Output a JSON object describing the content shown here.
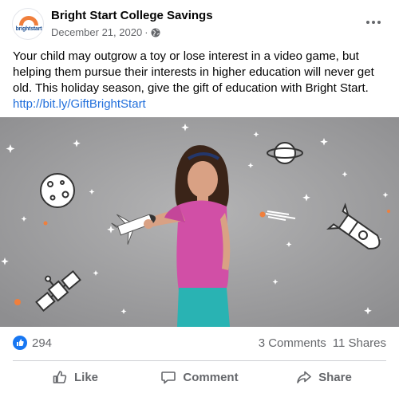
{
  "post": {
    "page_name": "Bright Start College Savings",
    "avatar_text": "brightstart",
    "date": "December 21, 2020",
    "separator": "·",
    "caption": "Your child may outgrow a toy or lose interest in a video game, but helping them pursue their interests in higher education will never get old. This holiday season, give the gift of education with Bright Start.",
    "link": "http://bit.ly/GiftBrightStart",
    "image_icon": "girl-with-toy-space-shuttle"
  },
  "stats": {
    "likes": "294",
    "comments": "3 Comments",
    "shares": "11 Shares"
  },
  "actions": {
    "like": "Like",
    "comment": "Comment",
    "share": "Share"
  },
  "colors": {
    "accent": "#1877f2",
    "link": "#216fdb",
    "photo_bg": "#9d9d9e",
    "logo_orange": "#f07f3c"
  }
}
